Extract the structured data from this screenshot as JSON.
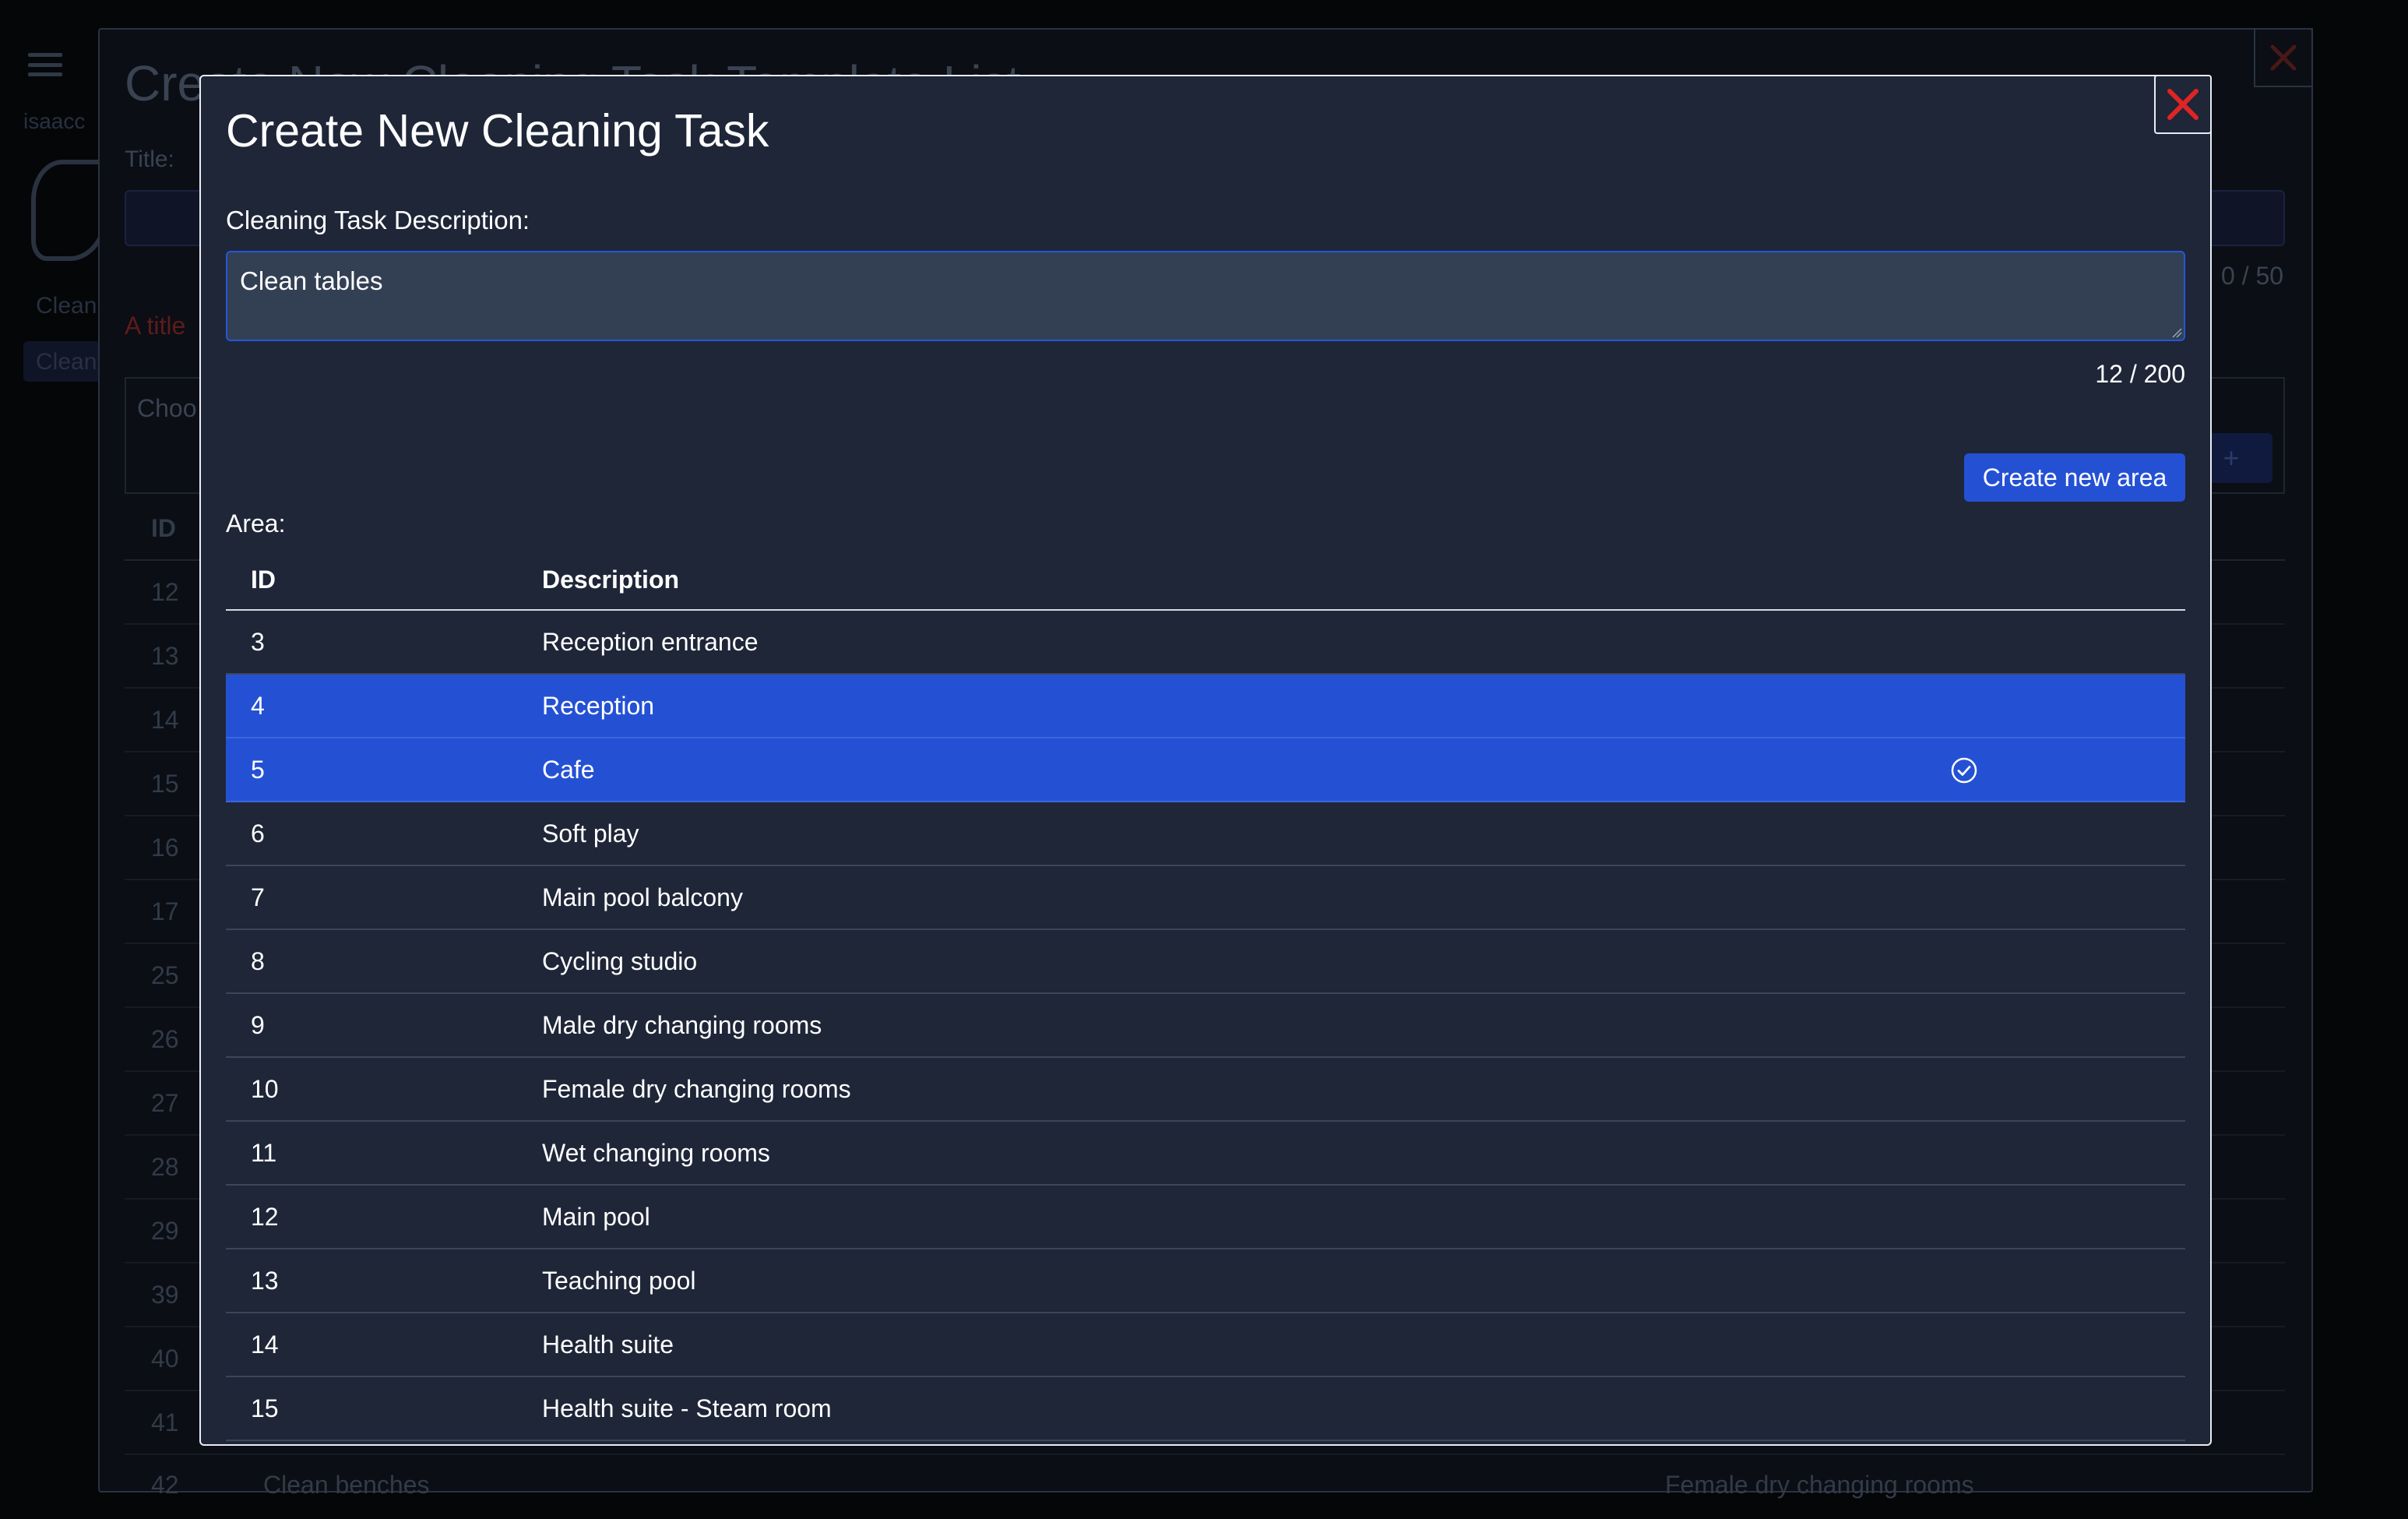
{
  "background": {
    "user": "isaacc",
    "title": "Create New Cleaning Task Template List",
    "title_label": "Title:",
    "title_counter": "0 / 50",
    "warning": "A title",
    "sidebar_item_1": "Clean",
    "sidebar_item_2": "Clean",
    "choose_label": "Choo",
    "new_button_icon": "+",
    "id_header": "ID",
    "row_ids": [
      "12",
      "13",
      "14",
      "15",
      "16",
      "17",
      "25",
      "26",
      "27",
      "28",
      "29",
      "39",
      "40",
      "41"
    ],
    "last_row": {
      "id": "42",
      "description": "Clean benches",
      "area": "Female dry changing rooms"
    }
  },
  "modal": {
    "title": "Create New Cleaning Task",
    "description_label": "Cleaning Task Description:",
    "description_value": "Clean tables",
    "description_counter": "12 / 200",
    "create_area_label": "Create new area",
    "area_label": "Area:",
    "close_icon": "close-x-icon",
    "table": {
      "headers": {
        "id": "ID",
        "description": "Description"
      },
      "rows": [
        {
          "id": "3",
          "description": "Reception entrance",
          "selected": false
        },
        {
          "id": "4",
          "description": "Reception",
          "selected": true
        },
        {
          "id": "5",
          "description": "Cafe",
          "selected": true,
          "checked": true
        },
        {
          "id": "6",
          "description": "Soft play",
          "selected": false
        },
        {
          "id": "7",
          "description": "Main pool balcony",
          "selected": false
        },
        {
          "id": "8",
          "description": "Cycling studio",
          "selected": false
        },
        {
          "id": "9",
          "description": "Male dry changing rooms",
          "selected": false
        },
        {
          "id": "10",
          "description": "Female dry changing rooms",
          "selected": false
        },
        {
          "id": "11",
          "description": "Wet changing rooms",
          "selected": false
        },
        {
          "id": "12",
          "description": "Main pool",
          "selected": false
        },
        {
          "id": "13",
          "description": "Teaching pool",
          "selected": false
        },
        {
          "id": "14",
          "description": "Health suite",
          "selected": false
        },
        {
          "id": "15",
          "description": "Health suite - Steam room",
          "selected": false
        }
      ]
    }
  },
  "colors": {
    "modal_bg": "#1e2638",
    "accent": "#2451d4",
    "close_red": "#e02424",
    "page_bg": "#050608"
  }
}
